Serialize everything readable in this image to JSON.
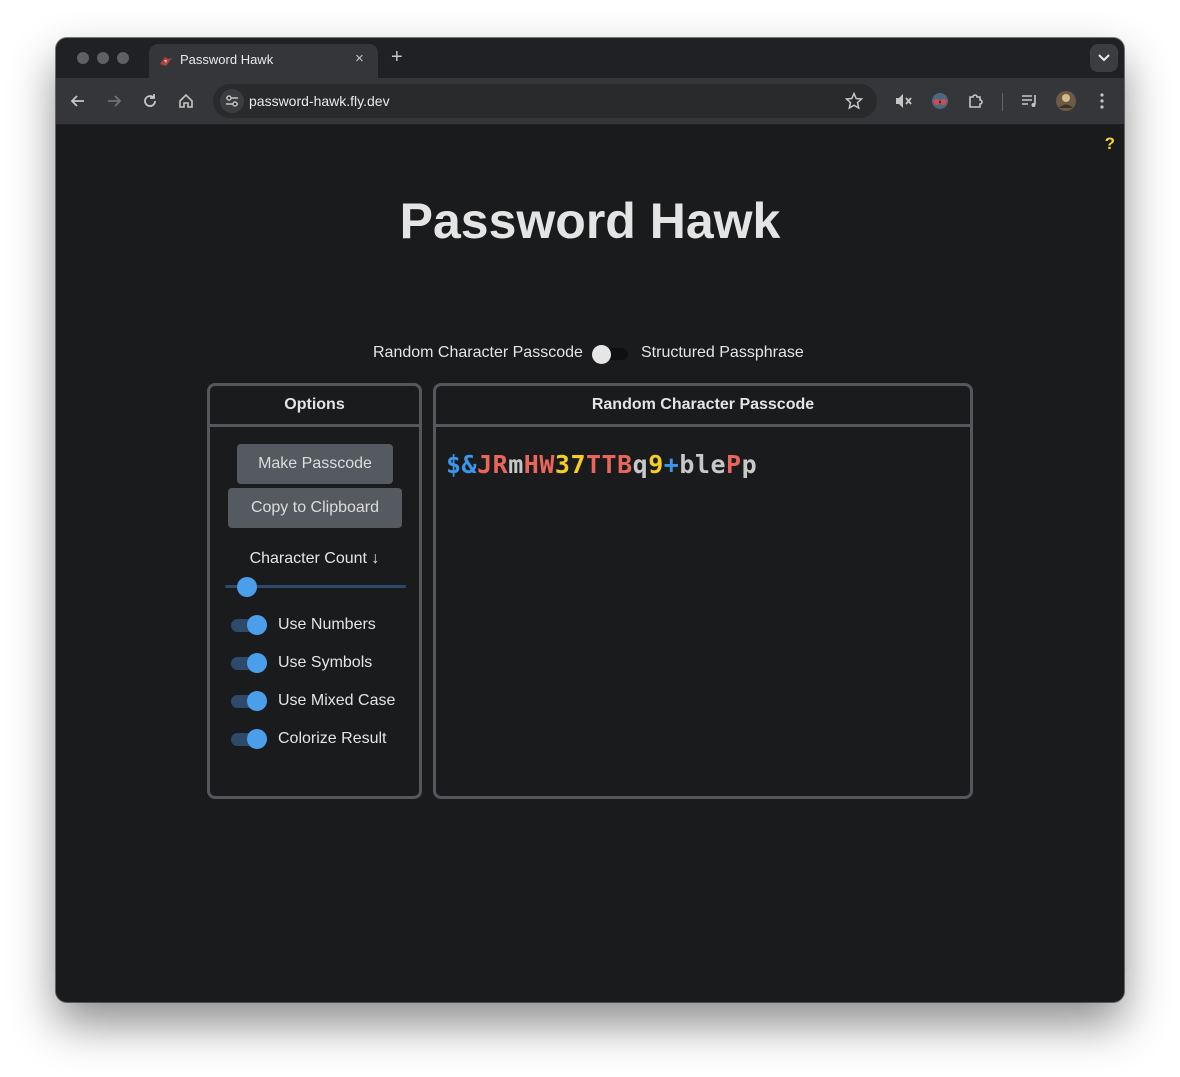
{
  "browser": {
    "tab_title": "Password Hawk",
    "tab_close": "×",
    "new_tab": "+",
    "url": "password-hawk.fly.dev"
  },
  "page": {
    "help": "?",
    "title": "Password Hawk",
    "mode_toggle": {
      "left_label": "Random Character Passcode",
      "right_label": "Structured Passphrase",
      "structured_selected": false
    }
  },
  "options": {
    "header": "Options",
    "make_button": "Make Passcode",
    "copy_button": "Copy to Clipboard",
    "count_label": "Character Count ↓",
    "count_slider_fraction": 0.12,
    "toggles": [
      {
        "label": "Use Numbers",
        "on": true
      },
      {
        "label": "Use Symbols",
        "on": true
      },
      {
        "label": "Use Mixed Case",
        "on": true
      },
      {
        "label": "Colorize Result",
        "on": true
      }
    ]
  },
  "output": {
    "header": "Random Character Passcode",
    "passcode_segments": [
      {
        "text": "$&",
        "color": "#3b95e8"
      },
      {
        "text": "JR",
        "color": "#e8665a"
      },
      {
        "text": "m",
        "color": "#c8c8c8"
      },
      {
        "text": "HW",
        "color": "#e8665a"
      },
      {
        "text": "37",
        "color": "#f4ce21"
      },
      {
        "text": "TTB",
        "color": "#e8665a"
      },
      {
        "text": "q",
        "color": "#c8c8c8"
      },
      {
        "text": "9",
        "color": "#f4ce21"
      },
      {
        "text": "+",
        "color": "#3b95e8"
      },
      {
        "text": "ble",
        "color": "#c8c8c8"
      },
      {
        "text": "P",
        "color": "#e8665a"
      },
      {
        "text": "p",
        "color": "#c8c8c8"
      }
    ]
  }
}
